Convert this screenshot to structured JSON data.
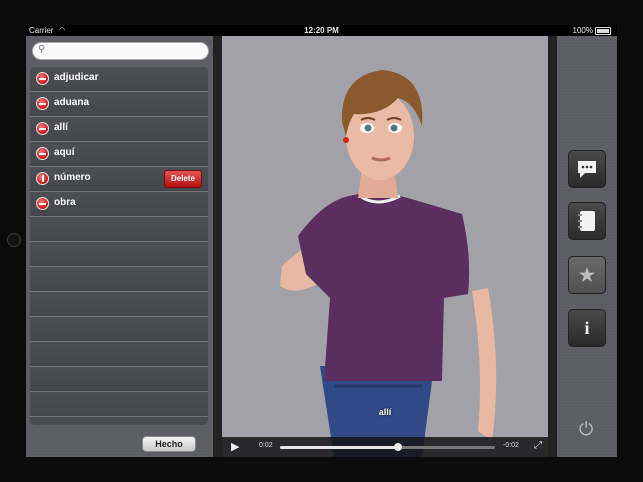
{
  "status_bar": {
    "carrier": "Carrier",
    "time": "12:20 PM",
    "battery": "100%"
  },
  "search": {
    "placeholder": "",
    "value": ""
  },
  "words": [
    {
      "label": "adjudicar",
      "rotated": false,
      "show_delete": false
    },
    {
      "label": "aduana",
      "rotated": false,
      "show_delete": false
    },
    {
      "label": "allí",
      "rotated": false,
      "show_delete": false
    },
    {
      "label": "aquí",
      "rotated": false,
      "show_delete": false
    },
    {
      "label": "número",
      "rotated": true,
      "show_delete": true
    },
    {
      "label": "obra",
      "rotated": false,
      "show_delete": false
    }
  ],
  "delete_label": "Delete",
  "done_button": "Hecho",
  "video": {
    "subtitle": "allí",
    "elapsed": "0:02",
    "remaining": "-0:02",
    "progress": 0.55
  },
  "toolbar": {
    "items": [
      {
        "name": "chat-icon",
        "glyph": "💬"
      },
      {
        "name": "notebook-icon",
        "glyph": "📓"
      },
      {
        "name": "star-icon",
        "glyph": "★"
      },
      {
        "name": "info-icon",
        "glyph": "i"
      }
    ],
    "power_icon": "power-icon"
  },
  "colors": {
    "delete_red": "#c71a1a",
    "panel_gray": "#5d5f63",
    "video_bg": "#a3a1a8"
  }
}
